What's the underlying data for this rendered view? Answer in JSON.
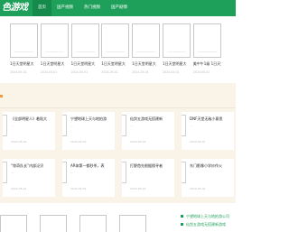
{
  "header": {
    "logo": "色游戏",
    "nav": [
      "首页",
      "国产视频",
      "热门视频",
      "国产剧情"
    ],
    "active_index": 0,
    "color": "#1fa05a"
  },
  "section1": {
    "cards": [
      {
        "title": "1日天堂明星大",
        "date": "2024-05-01"
      },
      {
        "title": "1日天堂明星大",
        "date": "2024-05-01"
      },
      {
        "title": "1日天堂明星大",
        "date": "2024-05-01"
      },
      {
        "title": "1日天堂明星大",
        "date": "2024-05-01"
      },
      {
        "title": "1日天堂明星大",
        "date": "2024-05-01"
      },
      {
        "title": "1日天堂明星大",
        "date": "2024-05-01"
      },
      {
        "title": "美中午1级 1日天堂",
        "date": "2024-05-01"
      },
      {
        "title": "1日天堂明星大",
        "date": "2024-05-01"
      }
    ]
  },
  "section2": {
    "accent": "#f09a3a",
    "cards": [
      {
        "title": "《全部明星人》着陆大",
        "desc": "…",
        "date": "2024-05-01"
      },
      {
        "title": "宁望地球上天与地拍游",
        "desc": "…",
        "date": "2024-05-01"
      },
      {
        "title": "仙剑五游戏无搭建新",
        "desc": "…",
        "date": "2024-05-01"
      },
      {
        "title": "DNF天堂无敌小意思",
        "desc": "…",
        "date": "2024-05-01"
      },
      {
        "title": "“惊奇队长”内部泛识",
        "desc": "…",
        "date": "2024-05-01"
      },
      {
        "title": "AR体第一都秒杀，表",
        "desc": "…",
        "date": "2024-05-01"
      },
      {
        "title": "打野首先根据搜寻者",
        "desc": "…",
        "date": "2024-05-01"
      },
      {
        "title": "东门影像小学炒作火",
        "desc": "…",
        "date": "2024-05-01"
      }
    ]
  },
  "bottom": {
    "side_items": [
      "宁望地球上天与地拍游公司",
      "仙剑五游戏无搭建新游戏"
    ]
  }
}
